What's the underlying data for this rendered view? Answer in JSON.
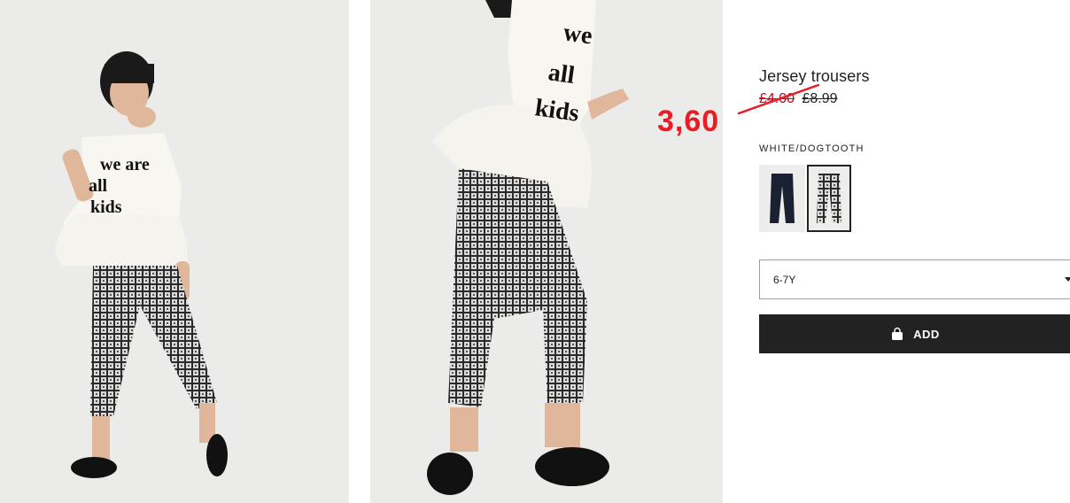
{
  "gallery": {
    "image_1": {
      "shirt_text": [
        "we are",
        "all",
        "kids"
      ]
    },
    "image_2": {
      "shirt_text": [
        "we",
        "all",
        "kids"
      ]
    }
  },
  "product": {
    "title": "Jersey trousers",
    "sale_price": "£4.00",
    "regular_price": "£8.99",
    "annotation_price": "3,60",
    "color_label": "WHITE/DOGTOOTH",
    "swatches": [
      {
        "name": "navy",
        "color": "#1c2033",
        "selected": false
      },
      {
        "name": "white-dogtooth",
        "color": "#9a9a9a",
        "selected": true
      }
    ],
    "size_selected": "6-7Y",
    "add_label": "ADD"
  },
  "colors": {
    "sale_red": "#d0021b",
    "annotation_red": "#ea1c24",
    "button_bg": "#222222",
    "select_border": "#7aa3e5"
  }
}
